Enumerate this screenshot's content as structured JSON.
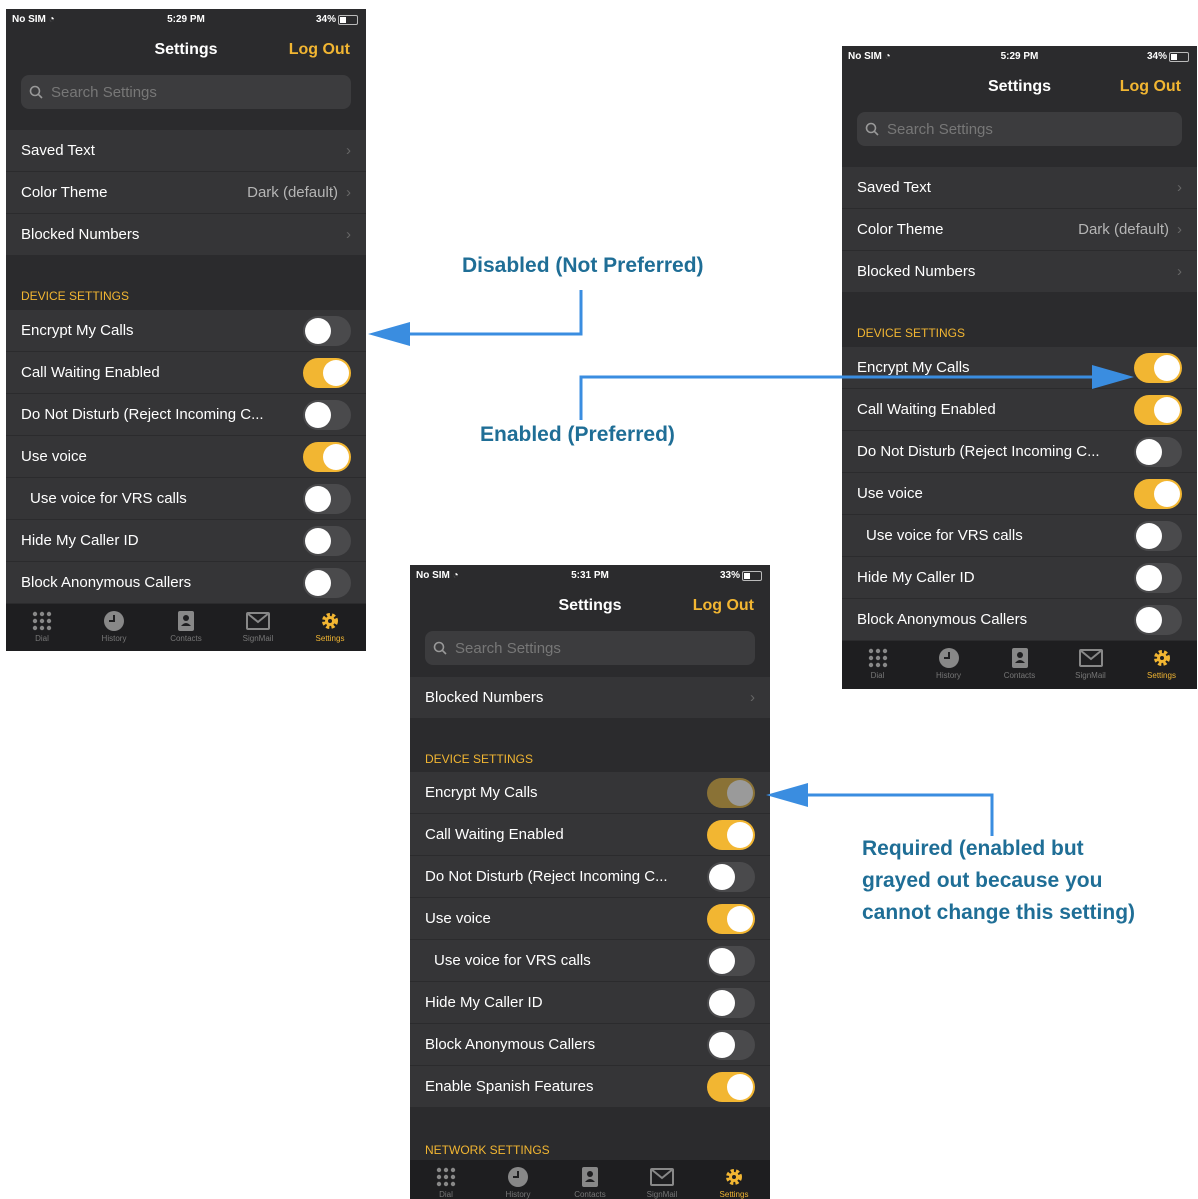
{
  "colors": {
    "accent": "#f2b632",
    "annotation": "#1f6e96",
    "arrow": "#3a8de0",
    "panel": "#2b2b2d"
  },
  "icons": [
    "wifi-icon",
    "battery-icon",
    "search-icon",
    "chevron-right-icon",
    "dial-icon",
    "history-icon",
    "contacts-icon",
    "signmail-icon",
    "settings-icon"
  ],
  "phone1": {
    "status": {
      "carrier": "No SIM",
      "time": "5:29 PM",
      "battery": "34%"
    },
    "title": "Settings",
    "logout": "Log Out",
    "search_placeholder": "Search Settings",
    "rows": [
      {
        "label": "Saved Text"
      },
      {
        "label": "Color Theme",
        "value": "Dark (default)"
      },
      {
        "label": "Blocked Numbers"
      }
    ],
    "section": "DEVICE SETTINGS",
    "toggles": [
      {
        "label": "Encrypt My Calls",
        "state": "off"
      },
      {
        "label": "Call Waiting Enabled",
        "state": "on"
      },
      {
        "label": "Do Not Disturb (Reject Incoming C...",
        "state": "off"
      },
      {
        "label": "Use voice",
        "state": "on"
      },
      {
        "label": "Use voice for VRS calls",
        "state": "off"
      },
      {
        "label": "Hide My Caller ID",
        "state": "off"
      },
      {
        "label": "Block Anonymous Callers",
        "state": "off"
      }
    ],
    "tabs": [
      "Dial",
      "History",
      "Contacts",
      "SignMail",
      "Settings"
    ]
  },
  "phone2": {
    "status": {
      "carrier": "No SIM",
      "time": "5:29 PM",
      "battery": "34%"
    },
    "title": "Settings",
    "logout": "Log Out",
    "search_placeholder": "Search Settings",
    "rows": [
      {
        "label": "Saved Text"
      },
      {
        "label": "Color Theme",
        "value": "Dark (default)"
      },
      {
        "label": "Blocked Numbers"
      }
    ],
    "section": "DEVICE SETTINGS",
    "toggles": [
      {
        "label": "Encrypt My Calls",
        "state": "on"
      },
      {
        "label": "Call Waiting Enabled",
        "state": "on"
      },
      {
        "label": "Do Not Disturb (Reject Incoming C...",
        "state": "off"
      },
      {
        "label": "Use voice",
        "state": "on"
      },
      {
        "label": "Use voice for VRS calls",
        "state": "off"
      },
      {
        "label": "Hide My Caller ID",
        "state": "off"
      },
      {
        "label": "Block Anonymous Callers",
        "state": "off"
      }
    ],
    "tabs": [
      "Dial",
      "History",
      "Contacts",
      "SignMail",
      "Settings"
    ]
  },
  "phone3": {
    "status": {
      "carrier": "No SIM",
      "time": "5:31 PM",
      "battery": "33%"
    },
    "title": "Settings",
    "logout": "Log Out",
    "search_placeholder": "Search Settings",
    "rows": [
      {
        "label": "Blocked Numbers"
      }
    ],
    "section": "DEVICE SETTINGS",
    "toggles": [
      {
        "label": "Encrypt My Calls",
        "state": "dim"
      },
      {
        "label": "Call Waiting Enabled",
        "state": "on"
      },
      {
        "label": "Do Not Disturb (Reject Incoming C...",
        "state": "off"
      },
      {
        "label": "Use voice",
        "state": "on"
      },
      {
        "label": "Use voice for VRS calls",
        "state": "off"
      },
      {
        "label": "Hide My Caller ID",
        "state": "off"
      },
      {
        "label": "Block Anonymous Callers",
        "state": "off"
      },
      {
        "label": "Enable Spanish Features",
        "state": "on"
      }
    ],
    "section2": "NETWORK SETTINGS",
    "tabs": [
      "Dial",
      "History",
      "Contacts",
      "SignMail",
      "Settings"
    ]
  },
  "annotations": {
    "disabled": "Disabled (Not Preferred)",
    "enabled": "Enabled (Preferred)",
    "required_line1": "Required (enabled but",
    "required_line2": "grayed out because you",
    "required_line3": "cannot change this setting)"
  }
}
